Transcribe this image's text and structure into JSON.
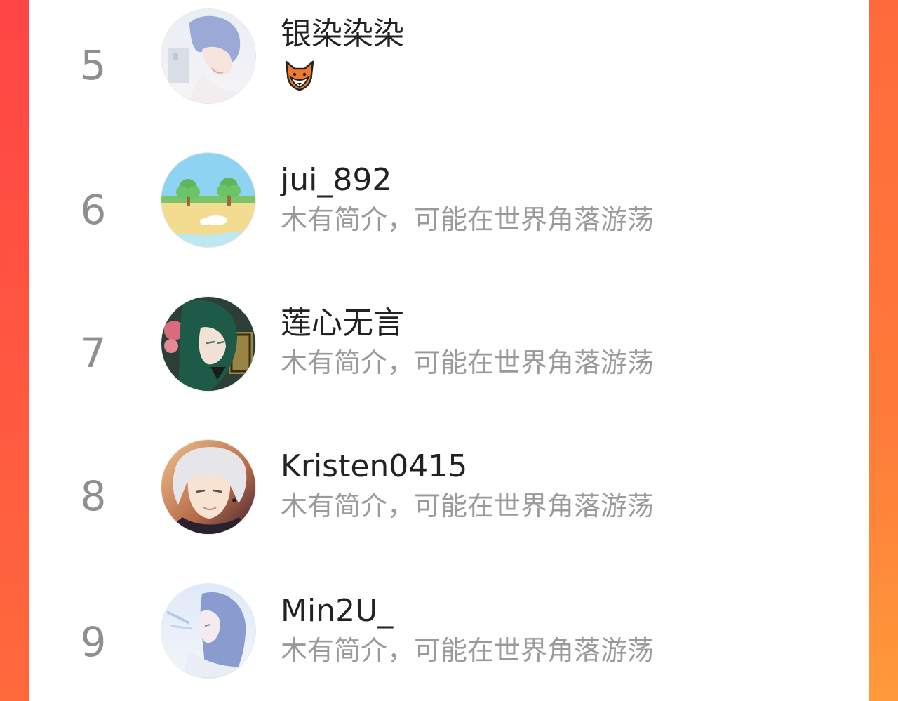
{
  "colors": {
    "accent_left": "#ff4545",
    "accent_right": "#ff8c3a",
    "rank_color": "#8f8f8f",
    "name_color": "#222222",
    "bio_color": "#9a9a9a"
  },
  "list": {
    "items": [
      {
        "rank": "5",
        "name": "银染染染",
        "bio_icon": "fox-face-emoji",
        "avatar": "anime-boy-blue-hair-avatar"
      },
      {
        "rank": "6",
        "name": "jui_892",
        "bio": "木有简介，可能在世界角落游荡",
        "avatar": "beach-trees-avatar"
      },
      {
        "rank": "7",
        "name": "莲心无言",
        "bio": "木有简介，可能在世界角落游荡",
        "avatar": "green-hair-girl-avatar"
      },
      {
        "rank": "8",
        "name": "Kristen0415",
        "bio": "木有简介，可能在世界角落游荡",
        "avatar": "silver-hair-boy-avatar"
      },
      {
        "rank": "9",
        "name": "Min2U_",
        "bio": "木有简介，可能在世界角落游荡",
        "avatar": "long-hair-sky-avatar"
      }
    ]
  }
}
